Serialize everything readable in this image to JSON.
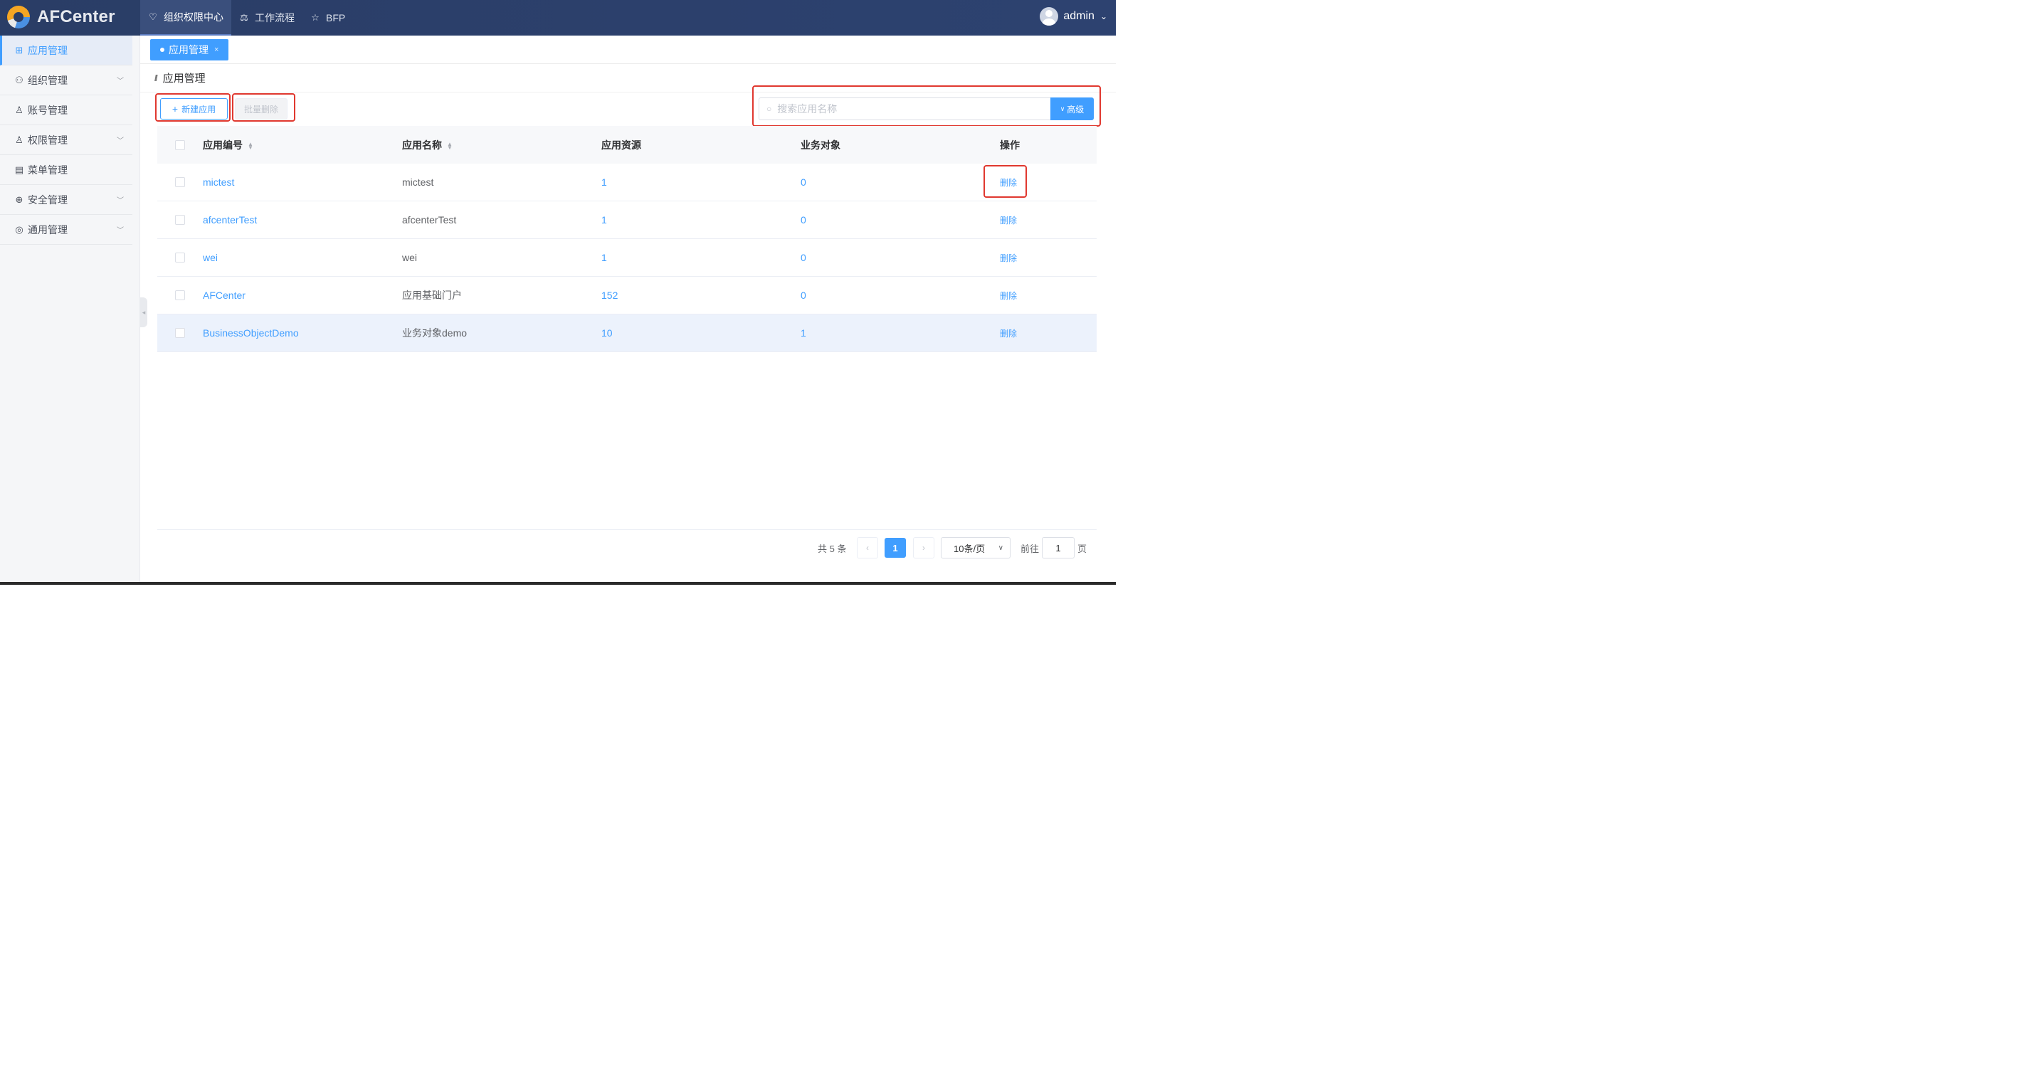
{
  "app": {
    "logo_text": "AFCenter"
  },
  "topnav": [
    {
      "label": "组织权限中心",
      "icon": "heart-shield-icon"
    },
    {
      "label": "工作流程",
      "icon": "scale-icon"
    },
    {
      "label": "BFP",
      "icon": "star-icon"
    }
  ],
  "user": {
    "name": "admin"
  },
  "sidebar": [
    {
      "label": "应用管理",
      "icon": "grid-icon"
    },
    {
      "label": "组织管理",
      "icon": "team-icon"
    },
    {
      "label": "账号管理",
      "icon": "user-icon"
    },
    {
      "label": "权限管理",
      "icon": "user-lock-icon"
    },
    {
      "label": "菜单管理",
      "icon": "menu-doc-icon"
    },
    {
      "label": "安全管理",
      "icon": "shield-plus-icon"
    },
    {
      "label": "通用管理",
      "icon": "settings-icon"
    }
  ],
  "tab": {
    "label": "应用管理",
    "close": "×"
  },
  "page": {
    "title": "应用管理"
  },
  "toolbar": {
    "new_label": "新建应用",
    "batch_delete_label": "批量删除",
    "search_placeholder": "搜索应用名称",
    "advanced_label": "高级"
  },
  "table": {
    "headers": [
      "应用编号",
      "应用名称",
      "应用资源",
      "业务对象",
      "操作"
    ],
    "rows": [
      {
        "code": "mictest",
        "name": "mictest",
        "resources": "1",
        "objects": "0",
        "action": "删除"
      },
      {
        "code": "afcenterTest",
        "name": "afcenterTest",
        "resources": "1",
        "objects": "0",
        "action": "删除"
      },
      {
        "code": "wei",
        "name": "wei",
        "resources": "1",
        "objects": "0",
        "action": "删除"
      },
      {
        "code": "AFCenter",
        "name": "应用基础门户",
        "resources": "152",
        "objects": "0",
        "action": "删除"
      },
      {
        "code": "BusinessObjectDemo",
        "name": "业务对象demo",
        "resources": "10",
        "objects": "1",
        "action": "删除"
      }
    ]
  },
  "pagination": {
    "total_text": "共 5 条",
    "current_page": "1",
    "page_size": "10条/页",
    "goto_label": "前往",
    "goto_value": "1",
    "page_suffix": "页"
  },
  "colors": {
    "primary": "#409eff",
    "header_bg": "#2a3d66",
    "highlight": "#e0382f"
  }
}
